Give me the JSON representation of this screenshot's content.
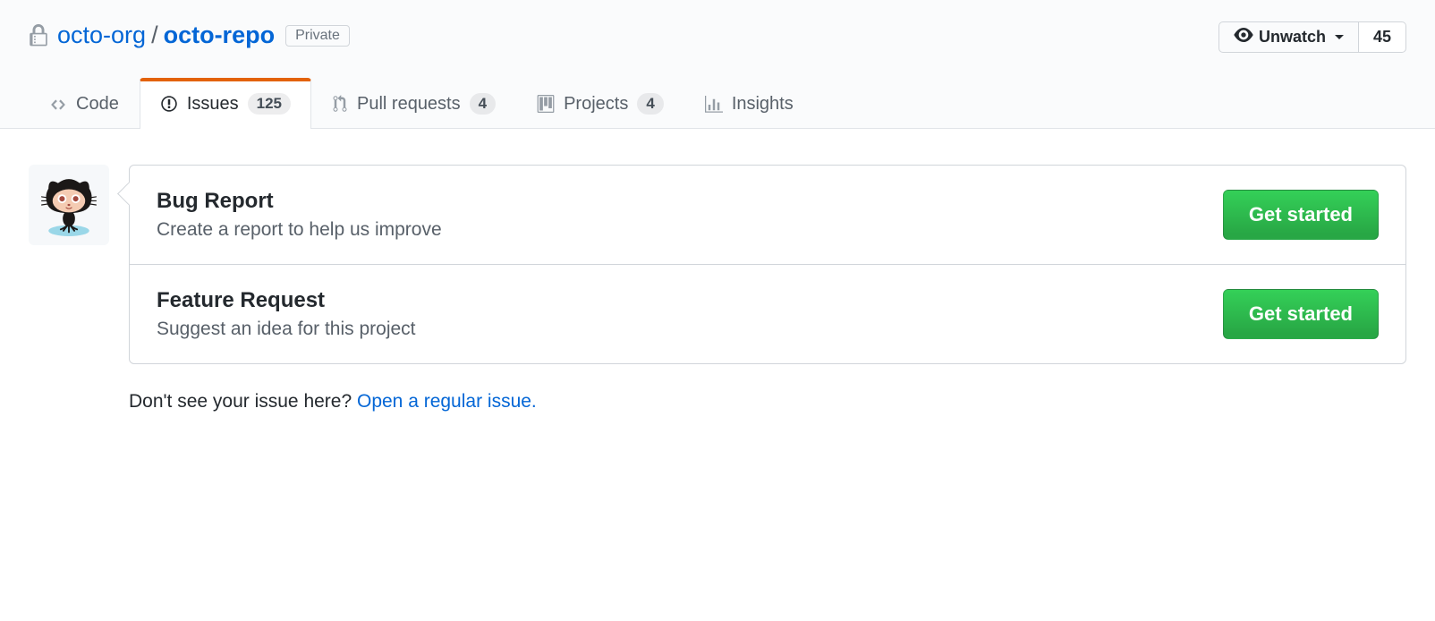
{
  "repo": {
    "owner": "octo-org",
    "name": "octo-repo",
    "separator": "/",
    "visibility": "Private"
  },
  "watch": {
    "label": "Unwatch",
    "count": "45"
  },
  "tabs": {
    "code": "Code",
    "issues": {
      "label": "Issues",
      "count": "125"
    },
    "pulls": {
      "label": "Pull requests",
      "count": "4"
    },
    "projects": {
      "label": "Projects",
      "count": "4"
    },
    "insights": "Insights"
  },
  "templates": [
    {
      "title": "Bug Report",
      "desc": "Create a report to help us improve",
      "btn": "Get started"
    },
    {
      "title": "Feature Request",
      "desc": "Suggest an idea for this project",
      "btn": "Get started"
    }
  ],
  "footer": {
    "prompt": "Don't see your issue here? ",
    "link": "Open a regular issue."
  }
}
